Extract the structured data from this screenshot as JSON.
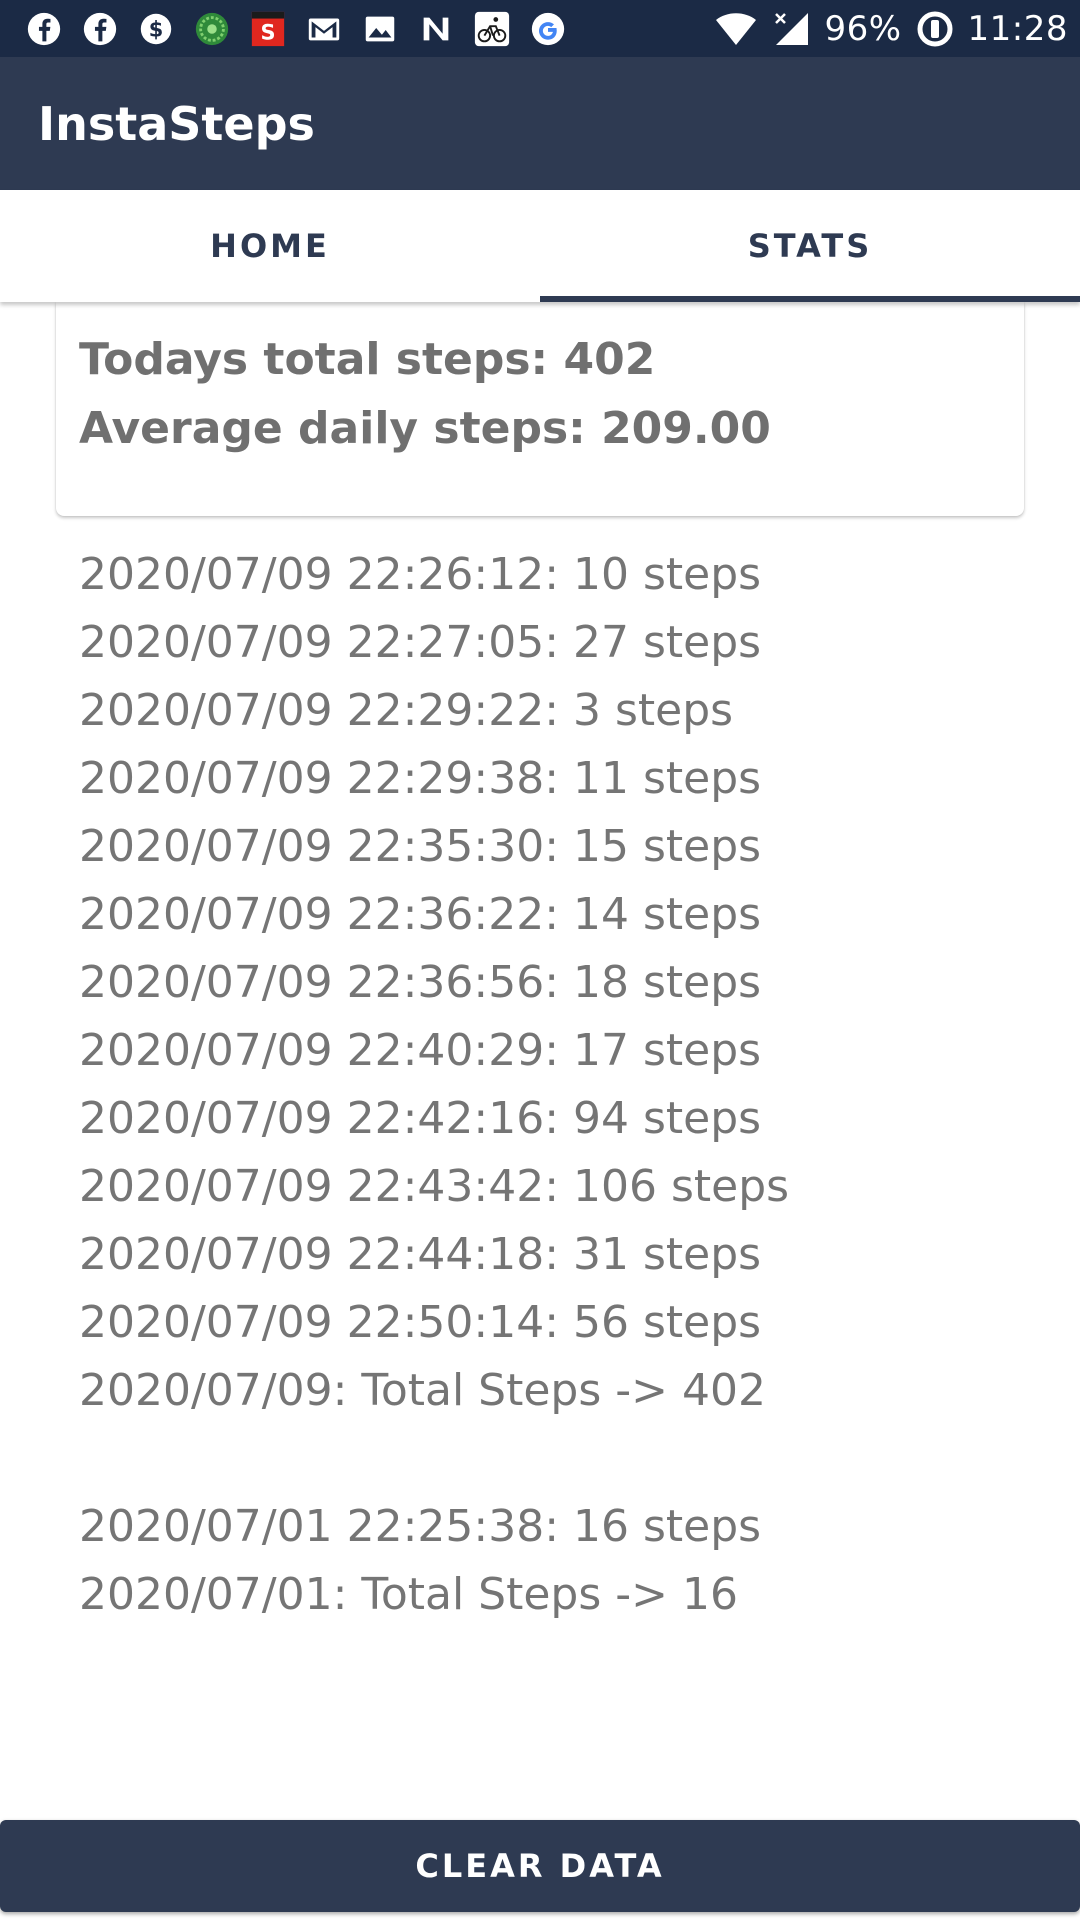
{
  "status_bar": {
    "notification_icons": [
      "facebook-icon",
      "facebook-icon",
      "dollar-icon",
      "quran-app-icon",
      "sonyliv-icon",
      "gmail-icon",
      "gallery-icon",
      "app-n-icon",
      "cycling-icon",
      "google-icon"
    ],
    "battery": "96%",
    "time": "11:28"
  },
  "app_bar": {
    "title": "InstaSteps"
  },
  "tabs": [
    {
      "label": "HOME",
      "selected": false
    },
    {
      "label": "STATS",
      "selected": true
    }
  ],
  "summary": {
    "today_total": "Todays total steps: 402",
    "average_daily": "Average daily steps: 209.00"
  },
  "log": {
    "day1": [
      "2020/07/09 22:26:12: 10 steps",
      "2020/07/09 22:27:05: 27 steps",
      "2020/07/09 22:29:22: 3 steps",
      "2020/07/09 22:29:38: 11 steps",
      "2020/07/09 22:35:30: 15 steps",
      "2020/07/09 22:36:22: 14 steps",
      "2020/07/09 22:36:56: 18 steps",
      "2020/07/09 22:40:29: 17 steps",
      "2020/07/09 22:42:16: 94 steps",
      "2020/07/09 22:43:42: 106 steps",
      "2020/07/09 22:44:18: 31 steps",
      "2020/07/09 22:50:14: 56 steps",
      "2020/07/09: Total Steps -> 402"
    ],
    "day2": [
      "2020/07/01 22:25:38: 16 steps",
      "2020/07/01: Total Steps -> 16"
    ]
  },
  "actions": {
    "clear_label": "CLEAR DATA"
  },
  "colors": {
    "status_bar": "#1b2a45",
    "primary": "#2e3a52",
    "text_gray": "#757575",
    "surface": "#ffffff"
  }
}
